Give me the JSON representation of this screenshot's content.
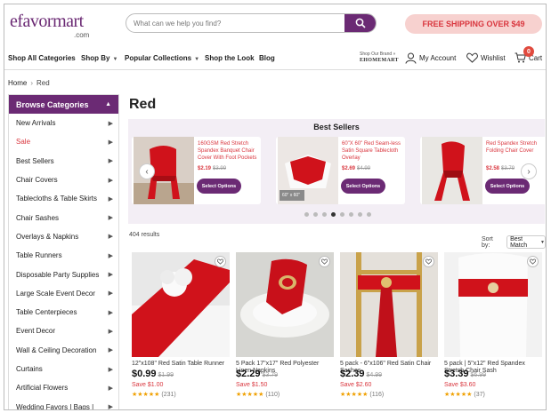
{
  "header": {
    "logo_text": "efavormart",
    "logo_sub": ".com",
    "search_placeholder": "What can we help you find?",
    "shipping_banner": "FREE SHIPPING OVER $49"
  },
  "nav": {
    "items": [
      "Shop All Categories",
      "Shop By",
      "Popular Collections",
      "Shop the Look",
      "Blog"
    ],
    "brand_tag_line": "Shop Our Brand »",
    "brand_tag_name": "EHOMEMART",
    "account": "My Account",
    "wishlist": "Wishlist",
    "cart": "Cart",
    "cart_count": "0"
  },
  "breadcrumb": {
    "home": "Home",
    "current": "Red"
  },
  "sidebar": {
    "title": "Browse Categories",
    "items": [
      {
        "label": "New Arrivals"
      },
      {
        "label": "Sale"
      },
      {
        "label": "Best Sellers"
      },
      {
        "label": "Chair Covers"
      },
      {
        "label": "Tablecloths & Table Skirts"
      },
      {
        "label": "Chair Sashes"
      },
      {
        "label": "Overlays & Napkins"
      },
      {
        "label": "Table Runners"
      },
      {
        "label": "Disposable Party Supplies"
      },
      {
        "label": "Large Scale Event Decor"
      },
      {
        "label": "Table Centerpieces"
      },
      {
        "label": "Event Decor"
      },
      {
        "label": "Wall & Ceiling Decoration"
      },
      {
        "label": "Curtains"
      },
      {
        "label": "Artificial Flowers"
      },
      {
        "label": "Wedding Favors | Bags |"
      }
    ]
  },
  "page_title": "Red",
  "best_sellers": {
    "title": "Best Sellers",
    "cards": [
      {
        "name": "160GSM Red Stretch Spandex Banquet Chair Cover With Foot Pockets",
        "price": "$2.19",
        "old_price": "$3.99",
        "button": "Select Options"
      },
      {
        "name": "60\"X 60\" Red Seam-less Satin Square Tablecloth Overlay",
        "price": "$2.69",
        "old_price": "$4.99",
        "button": "Select Options",
        "size_tag": "60\" x 60\""
      },
      {
        "name": "Red Spandex Stretch Folding Chair Cover",
        "price": "$2.58",
        "old_price": "$3.79",
        "button": "Select Options"
      }
    ]
  },
  "results": {
    "count_text": "404 results",
    "sort_label": "Sort by:",
    "sort_value": "Best Match"
  },
  "products": [
    {
      "name": "12\"x108\" Red Satin Table Runner",
      "price": "$0.99",
      "old_price": "$1.99",
      "save": "Save $1.00",
      "stars": "★★★★★",
      "reviews": "(231)"
    },
    {
      "name": "5 Pack 17\"x17\" Red Polyester Linen Napkins",
      "price": "$2.29",
      "old_price": "$3.79",
      "save": "Save $1.50",
      "stars": "★★★★★",
      "reviews": "(110)"
    },
    {
      "name": "5 pack - 6\"x106\" Red Satin Chair Sashes",
      "price": "$2.39",
      "old_price": "$4.99",
      "save": "Save $2.60",
      "stars": "★★★★★",
      "reviews": "(116)"
    },
    {
      "name": "5 pack | 5\"x12\" Red Spandex Stretch Chair Sash",
      "price": "$3.39",
      "old_price": "$6.99",
      "save": "Save $3.60",
      "stars": "★★★★★",
      "reviews": "(37)"
    }
  ],
  "colors": {
    "brand": "#6b2a74",
    "accent": "#d9363e",
    "banner_bg": "#f7d1cf",
    "carousel_bg": "#f3eef5"
  }
}
